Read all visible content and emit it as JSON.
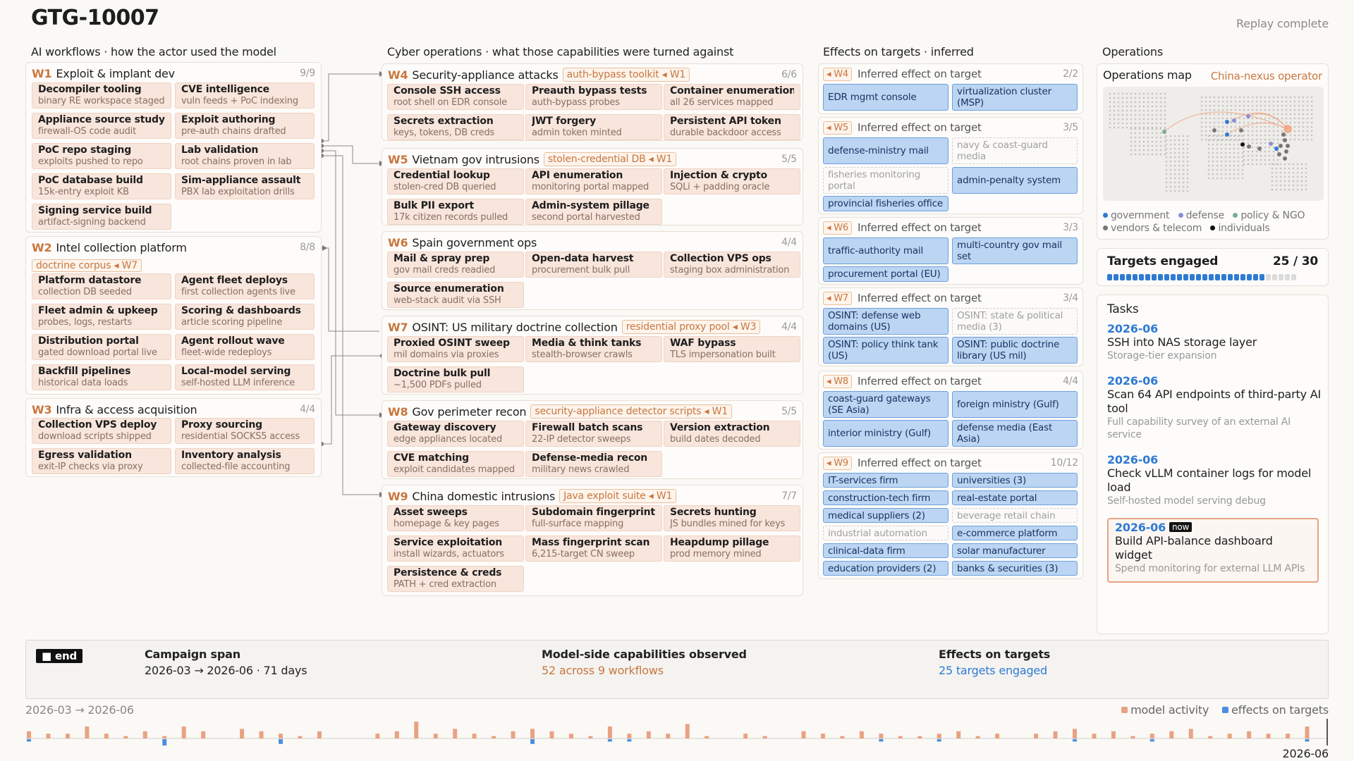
{
  "header": {
    "title": "GTG-10007",
    "status": "Replay complete"
  },
  "columns": {
    "ai": "AI workflows · how the actor used the model",
    "cyber": "Cyber operations · what those capabilities were turned against",
    "effects": "Effects on targets · inferred",
    "ops": "Operations"
  },
  "workflows": [
    {
      "id": "W1",
      "title": "Exploit & implant dev",
      "count": "9/9",
      "cards": [
        {
          "t": "Decompiler tooling",
          "s": "binary RE workspace staged"
        },
        {
          "t": "CVE intelligence",
          "s": "vuln feeds + PoC indexing"
        },
        {
          "t": "Appliance source study",
          "s": "firewall-OS code audit"
        },
        {
          "t": "Exploit authoring",
          "s": "pre-auth chains drafted"
        },
        {
          "t": "PoC repo staging",
          "s": "exploits pushed to repo"
        },
        {
          "t": "Lab validation",
          "s": "root chains proven in lab"
        },
        {
          "t": "PoC database build",
          "s": "15k-entry exploit KB"
        },
        {
          "t": "Sim-appliance assault",
          "s": "PBX lab exploitation drills"
        },
        {
          "t": "Signing service build",
          "s": "artifact-signing backend"
        }
      ]
    },
    {
      "id": "W2",
      "title": "Intel collection platform",
      "count": "8/8",
      "tag": "doctrine corpus ◂ W7",
      "cards": [
        {
          "t": "Platform datastore",
          "s": "collection DB seeded"
        },
        {
          "t": "Agent fleet deploys",
          "s": "first collection agents live"
        },
        {
          "t": "Fleet admin & upkeep",
          "s": "probes, logs, restarts"
        },
        {
          "t": "Scoring & dashboards",
          "s": "article scoring pipeline"
        },
        {
          "t": "Distribution portal",
          "s": "gated download portal live"
        },
        {
          "t": "Agent rollout wave",
          "s": "fleet-wide redeploys"
        },
        {
          "t": "Backfill pipelines",
          "s": "historical data loads"
        },
        {
          "t": "Local-model serving",
          "s": "self-hosted LLM inference"
        }
      ]
    },
    {
      "id": "W3",
      "title": "Infra & access acquisition",
      "count": "4/4",
      "cards": [
        {
          "t": "Collection VPS deploy",
          "s": "download scripts shipped"
        },
        {
          "t": "Proxy sourcing",
          "s": "residential SOCKS5 access"
        },
        {
          "t": "Egress validation",
          "s": "exit-IP checks via proxy"
        },
        {
          "t": "Inventory analysis",
          "s": "collected-file accounting"
        }
      ]
    }
  ],
  "cyber": [
    {
      "id": "W4",
      "title": "Security-appliance attacks",
      "tag": "auth-bypass toolkit ◂ W1",
      "count": "6/6",
      "cards": [
        {
          "t": "Console SSH access",
          "s": "root shell on EDR console"
        },
        {
          "t": "Preauth bypass tests",
          "s": "auth-bypass probes"
        },
        {
          "t": "Container enumeration",
          "s": "all 26 services mapped"
        },
        {
          "t": "Secrets extraction",
          "s": "keys, tokens, DB creds"
        },
        {
          "t": "JWT forgery",
          "s": "admin token minted"
        },
        {
          "t": "Persistent API token",
          "s": "durable backdoor access"
        }
      ]
    },
    {
      "id": "W5",
      "title": "Vietnam gov intrusions",
      "tag": "stolen-credential DB ◂ W1",
      "count": "5/5",
      "cards": [
        {
          "t": "Credential lookup",
          "s": "stolen-cred DB queried"
        },
        {
          "t": "API enumeration",
          "s": "monitoring portal mapped"
        },
        {
          "t": "Injection & crypto",
          "s": "SQLi + padding oracle"
        },
        {
          "t": "Bulk PII export",
          "s": "17k citizen records pulled"
        },
        {
          "t": "Admin-system pillage",
          "s": "second portal harvested"
        }
      ]
    },
    {
      "id": "W6",
      "title": "Spain government ops",
      "count": "4/4",
      "cards": [
        {
          "t": "Mail & spray prep",
          "s": "gov mail creds readied"
        },
        {
          "t": "Open-data harvest",
          "s": "procurement bulk pull"
        },
        {
          "t": "Collection VPS ops",
          "s": "staging box administration"
        },
        {
          "t": "Source enumeration",
          "s": "web-stack audit via SSH"
        }
      ]
    },
    {
      "id": "W7",
      "title": "OSINT: US military doctrine collection",
      "tag": "residential proxy pool ◂ W3",
      "count": "4/4",
      "cards": [
        {
          "t": "Proxied OSINT sweep",
          "s": "mil domains via proxies"
        },
        {
          "t": "Media & think tanks",
          "s": "stealth-browser crawls"
        },
        {
          "t": "WAF bypass",
          "s": "TLS impersonation built"
        },
        {
          "t": "Doctrine bulk pull",
          "s": "~1,500 PDFs pulled"
        }
      ]
    },
    {
      "id": "W8",
      "title": "Gov perimeter recon",
      "tag": "security-appliance detector scripts ◂ W1",
      "count": "5/5",
      "cards": [
        {
          "t": "Gateway discovery",
          "s": "edge appliances located"
        },
        {
          "t": "Firewall batch scans",
          "s": "22-IP detector sweeps"
        },
        {
          "t": "Version extraction",
          "s": "build dates decoded"
        },
        {
          "t": "CVE matching",
          "s": "exploit candidates mapped"
        },
        {
          "t": "Defense-media recon",
          "s": "military news crawled"
        }
      ]
    },
    {
      "id": "W9",
      "title": "China domestic intrusions",
      "tag": "Java exploit suite ◂ W1",
      "count": "7/7",
      "cards": [
        {
          "t": "Asset sweeps",
          "s": "homepage & key pages"
        },
        {
          "t": "Subdomain fingerprint",
          "s": "full-surface mapping"
        },
        {
          "t": "Secrets hunting",
          "s": "JS bundles mined for keys"
        },
        {
          "t": "Service exploitation",
          "s": "install wizards, actuators"
        },
        {
          "t": "Mass fingerprint scan",
          "s": "6,215-target CN sweep"
        },
        {
          "t": "Heapdump pillage",
          "s": "prod memory mined"
        },
        {
          "t": "Persistence & creds",
          "s": "PATH + cred extraction"
        }
      ]
    }
  ],
  "effects": [
    {
      "tag": "◂ W4",
      "label": "Inferred effect on target",
      "count": "2/2",
      "items": [
        {
          "t": "EDR mgmt console (MSP)",
          "on": true
        },
        {
          "t": "virtualization cluster (MSP)",
          "on": true
        }
      ]
    },
    {
      "tag": "◂ W5",
      "label": "Inferred effect on target",
      "count": "3/5",
      "items": [
        {
          "t": "defense-ministry mail",
          "on": true
        },
        {
          "t": "navy & coast-guard media",
          "on": false
        },
        {
          "t": "fisheries monitoring portal",
          "on": false
        },
        {
          "t": "admin-penalty system",
          "on": true
        },
        {
          "t": "provincial fisheries office",
          "on": true
        }
      ]
    },
    {
      "tag": "◂ W6",
      "label": "Inferred effect on target",
      "count": "3/3",
      "items": [
        {
          "t": "traffic-authority mail (EU)",
          "on": true
        },
        {
          "t": "multi-country gov mail set",
          "on": true
        },
        {
          "t": "procurement portal (EU)",
          "on": true
        }
      ]
    },
    {
      "tag": "◂ W7",
      "label": "Inferred effect on target",
      "count": "3/4",
      "items": [
        {
          "t": "OSINT: defense web domains (US)",
          "on": true
        },
        {
          "t": "OSINT: state & political media (3)",
          "on": false
        },
        {
          "t": "OSINT: policy think tank (US)",
          "on": true
        },
        {
          "t": "OSINT: public doctrine library (US mil)",
          "on": true
        }
      ]
    },
    {
      "tag": "◂ W8",
      "label": "Inferred effect on target",
      "count": "4/4",
      "items": [
        {
          "t": "coast-guard gateways (SE Asia)",
          "on": true
        },
        {
          "t": "foreign ministry (Gulf)",
          "on": true
        },
        {
          "t": "interior ministry (Gulf)",
          "on": true
        },
        {
          "t": "defense media (East Asia)",
          "on": true
        }
      ]
    },
    {
      "tag": "◂ W9",
      "label": "Inferred effect on target",
      "count": "10/12",
      "items": [
        {
          "t": "IT-services firm",
          "on": true
        },
        {
          "t": "universities (3)",
          "on": true
        },
        {
          "t": "construction-tech firm",
          "on": true
        },
        {
          "t": "real-estate portal",
          "on": true
        },
        {
          "t": "medical suppliers (2)",
          "on": true
        },
        {
          "t": "beverage retail chain",
          "on": false
        },
        {
          "t": "industrial automation firm",
          "on": false
        },
        {
          "t": "e-commerce platform",
          "on": true
        },
        {
          "t": "clinical-data firm",
          "on": true
        },
        {
          "t": "solar manufacturer",
          "on": true
        },
        {
          "t": "education providers (2)",
          "on": true
        },
        {
          "t": "banks & securities (3)",
          "on": true
        }
      ]
    }
  ],
  "ops": {
    "map_title": "Operations map",
    "operator": "China-nexus operator",
    "legend": [
      "government",
      "defense",
      "policy & NGO",
      "vendors & telecom",
      "individuals"
    ],
    "legend_colors": [
      "#2f7ad3",
      "#8c8fd8",
      "#7aab96",
      "#777777",
      "#111111"
    ],
    "targets_label": "Targets engaged",
    "targets_value": "25 / 30",
    "targets_engaged": 25,
    "targets_total": 30,
    "tasks_title": "Tasks",
    "tasks": [
      {
        "date": "2026-06",
        "t": "SSH into NAS storage layer",
        "s": "Storage-tier expansion"
      },
      {
        "date": "2026-06",
        "t": "Scan 64 API endpoints of third-party AI tool",
        "s": "Full capability survey of an external AI service"
      },
      {
        "date": "2026-06",
        "t": "Check vLLM container logs for model load",
        "s": "Self-hosted model serving debug"
      },
      {
        "date": "2026-06",
        "now": "now",
        "t": "Build API-balance dashboard widget",
        "s": "Spend monitoring for external LLM APIs"
      }
    ]
  },
  "footer": {
    "end": "■ end",
    "span_label": "Campaign span",
    "span_value": "2026-03 → 2026-06 · 71 days",
    "cap_label": "Model-side capabilities observed",
    "cap_value": "52 across 9 workflows",
    "eff_label": "Effects on targets",
    "eff_value": "25 targets engaged"
  },
  "timeline": {
    "range": "2026-03 → 2026-06",
    "end_label": "2026-06",
    "legend_model": "model activity",
    "legend_effect": "effects on targets",
    "colors": {
      "model": "#e8a283",
      "effect": "#4b8fdf"
    },
    "model": [
      3,
      2,
      2,
      5,
      2,
      1,
      3,
      1,
      5,
      3,
      0,
      4,
      3,
      2,
      1,
      3,
      0,
      0,
      2,
      3,
      7,
      2,
      4,
      2,
      1,
      3,
      4,
      3,
      2,
      1,
      5,
      2,
      3,
      2,
      6,
      1,
      0,
      2,
      1,
      0,
      3,
      2,
      1,
      3,
      2,
      1,
      1,
      2,
      3,
      1,
      2,
      0,
      2,
      3,
      4,
      2,
      3,
      1,
      2,
      3,
      4,
      1,
      2,
      3,
      2,
      2,
      5
    ],
    "effect": [
      1,
      0,
      0,
      0,
      0,
      0,
      0,
      3,
      0,
      0,
      0,
      0,
      0,
      2,
      0,
      0,
      0,
      0,
      0,
      0,
      0,
      0,
      0,
      0,
      0,
      0,
      2,
      0,
      0,
      0,
      1,
      1,
      0,
      0,
      0,
      0,
      0,
      0,
      0,
      0,
      0,
      0,
      0,
      0,
      1,
      0,
      0,
      1,
      0,
      0,
      0,
      0,
      0,
      0,
      1,
      0,
      0,
      0,
      1,
      0,
      0,
      0,
      0,
      0,
      0,
      0,
      1
    ]
  }
}
